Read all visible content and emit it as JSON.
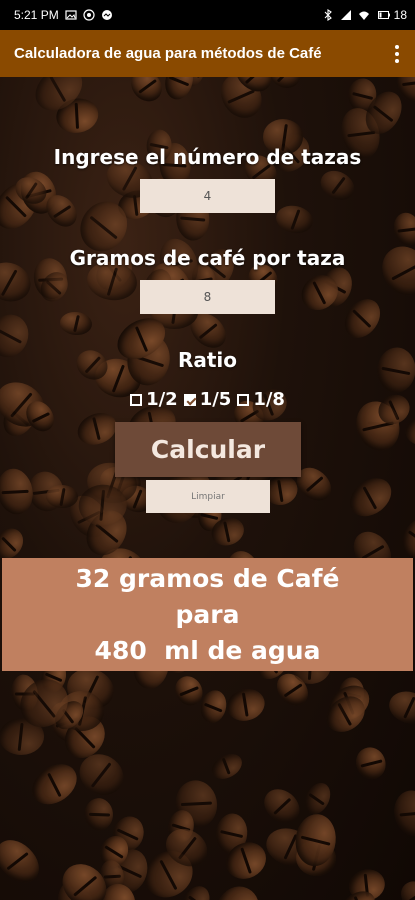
{
  "status_bar": {
    "time": "5:21 PM",
    "battery": "18"
  },
  "app_bar": {
    "title": "Calculadora de agua para métodos de Café"
  },
  "form": {
    "cups_label": "Ingrese el número de tazas",
    "cups_value": "4",
    "grams_label": "Gramos de café por taza",
    "grams_value": "8",
    "ratio_label": "Ratio",
    "ratio_options": [
      {
        "label": "1/2",
        "checked": false
      },
      {
        "label": "1/5",
        "checked": true
      },
      {
        "label": "1/8",
        "checked": false
      }
    ],
    "calculate_label": "Calcular",
    "clear_label": "Limpiar"
  },
  "result": {
    "line1": "32 gramos de Café",
    "line2": "para",
    "line3": "480  ml de agua"
  },
  "colors": {
    "app_bar": "#8a4a00",
    "result_bg": "#c08060",
    "calc_button": "#6e4a38",
    "field_bg": "#eee2d8"
  },
  "icons": {
    "status_left": [
      "gallery-icon",
      "whatsapp-icon",
      "messenger-icon"
    ],
    "status_right": [
      "bluetooth-icon",
      "signal-icon",
      "wifi-icon",
      "battery-icon"
    ],
    "menu": "overflow-menu-icon"
  }
}
